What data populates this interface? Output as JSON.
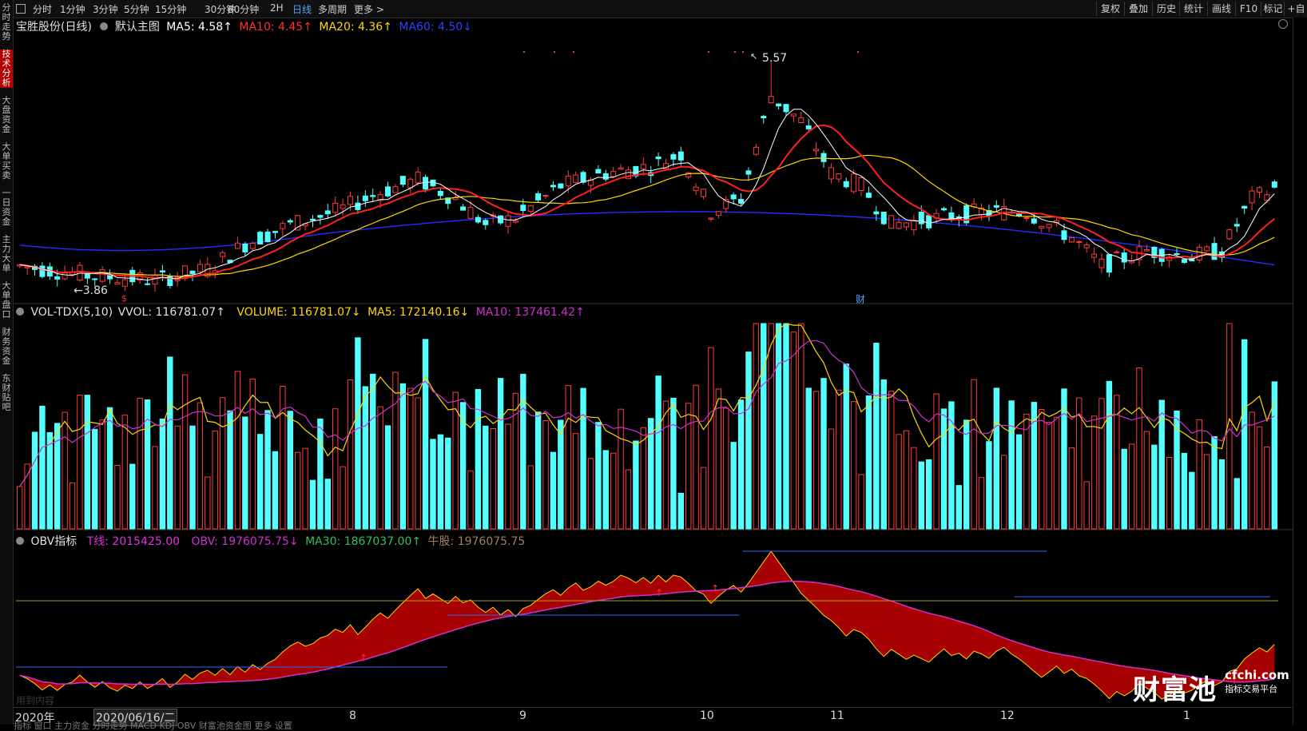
{
  "toolbar": {
    "periods": [
      "分时",
      "1分钟",
      "3分钟",
      "5分钟",
      "15分钟",
      "30分钟",
      "60分钟",
      "2H",
      "日线",
      "多周期",
      "更多 >"
    ],
    "active_period": "日线",
    "right_buttons": [
      "复权",
      "叠加",
      "历史",
      "统计",
      "画线",
      "F10",
      "标记",
      "+自"
    ]
  },
  "sidebar": {
    "tabs": [
      "分时走势",
      "技术分析",
      "大盘资金",
      "大单买卖",
      "一日资金",
      "主力大单",
      "大单盘口",
      "财务资金",
      "东财贴吧"
    ],
    "active_index": 1
  },
  "main_panel": {
    "stock_name": "宝胜股份(日线)",
    "template": "默认主图",
    "ma5": "MA5: 4.58↑",
    "ma10": "MA10: 4.45↑",
    "ma20": "MA20: 4.36↑",
    "ma60": "MA60: 4.50↓",
    "high_label": "5.57",
    "low_label": "←3.86",
    "marker_s": "$",
    "marker_cai": "财"
  },
  "vol_panel": {
    "name": "VOL-TDX(5,10)",
    "vvol": "VVOL: 116781.07↑",
    "volume": "VOLUME: 116781.07↓",
    "ma5": "MA5: 172140.16↓",
    "ma10": "MA10: 137461.42↑"
  },
  "obv_panel": {
    "name": "OBV指标",
    "t_line": "T线: 2015425.00",
    "obv": "OBV: 1976075.75↓",
    "ma30": "MA30: 1867037.00↑",
    "niugu": "牛股: 1976075.75",
    "faint_text": "用到内容"
  },
  "xaxis": {
    "year": "2020年",
    "cursor_date": "2020/06/16/二",
    "months": [
      "8",
      "9",
      "10",
      "11",
      "12",
      "1"
    ]
  },
  "bottom_partial": "指标 窗口 主力资金 分时走势 MACD  KDJ  OBV  财富池资金图  更多  设置",
  "watermark": {
    "brand": "财富池",
    "site": "cfchi.com",
    "slogan": "指标交易平台"
  },
  "colors": {
    "up": "#ff3b3b",
    "down": "#54ffff",
    "ma5": "#ffffff",
    "ma10": "#ff2020",
    "ma20": "#ffd700",
    "ma60": "#2a2aff",
    "vol_ma10": "#d030d0",
    "obv_red": "#b80000",
    "obv_navy": "#1a1a7a"
  }
}
